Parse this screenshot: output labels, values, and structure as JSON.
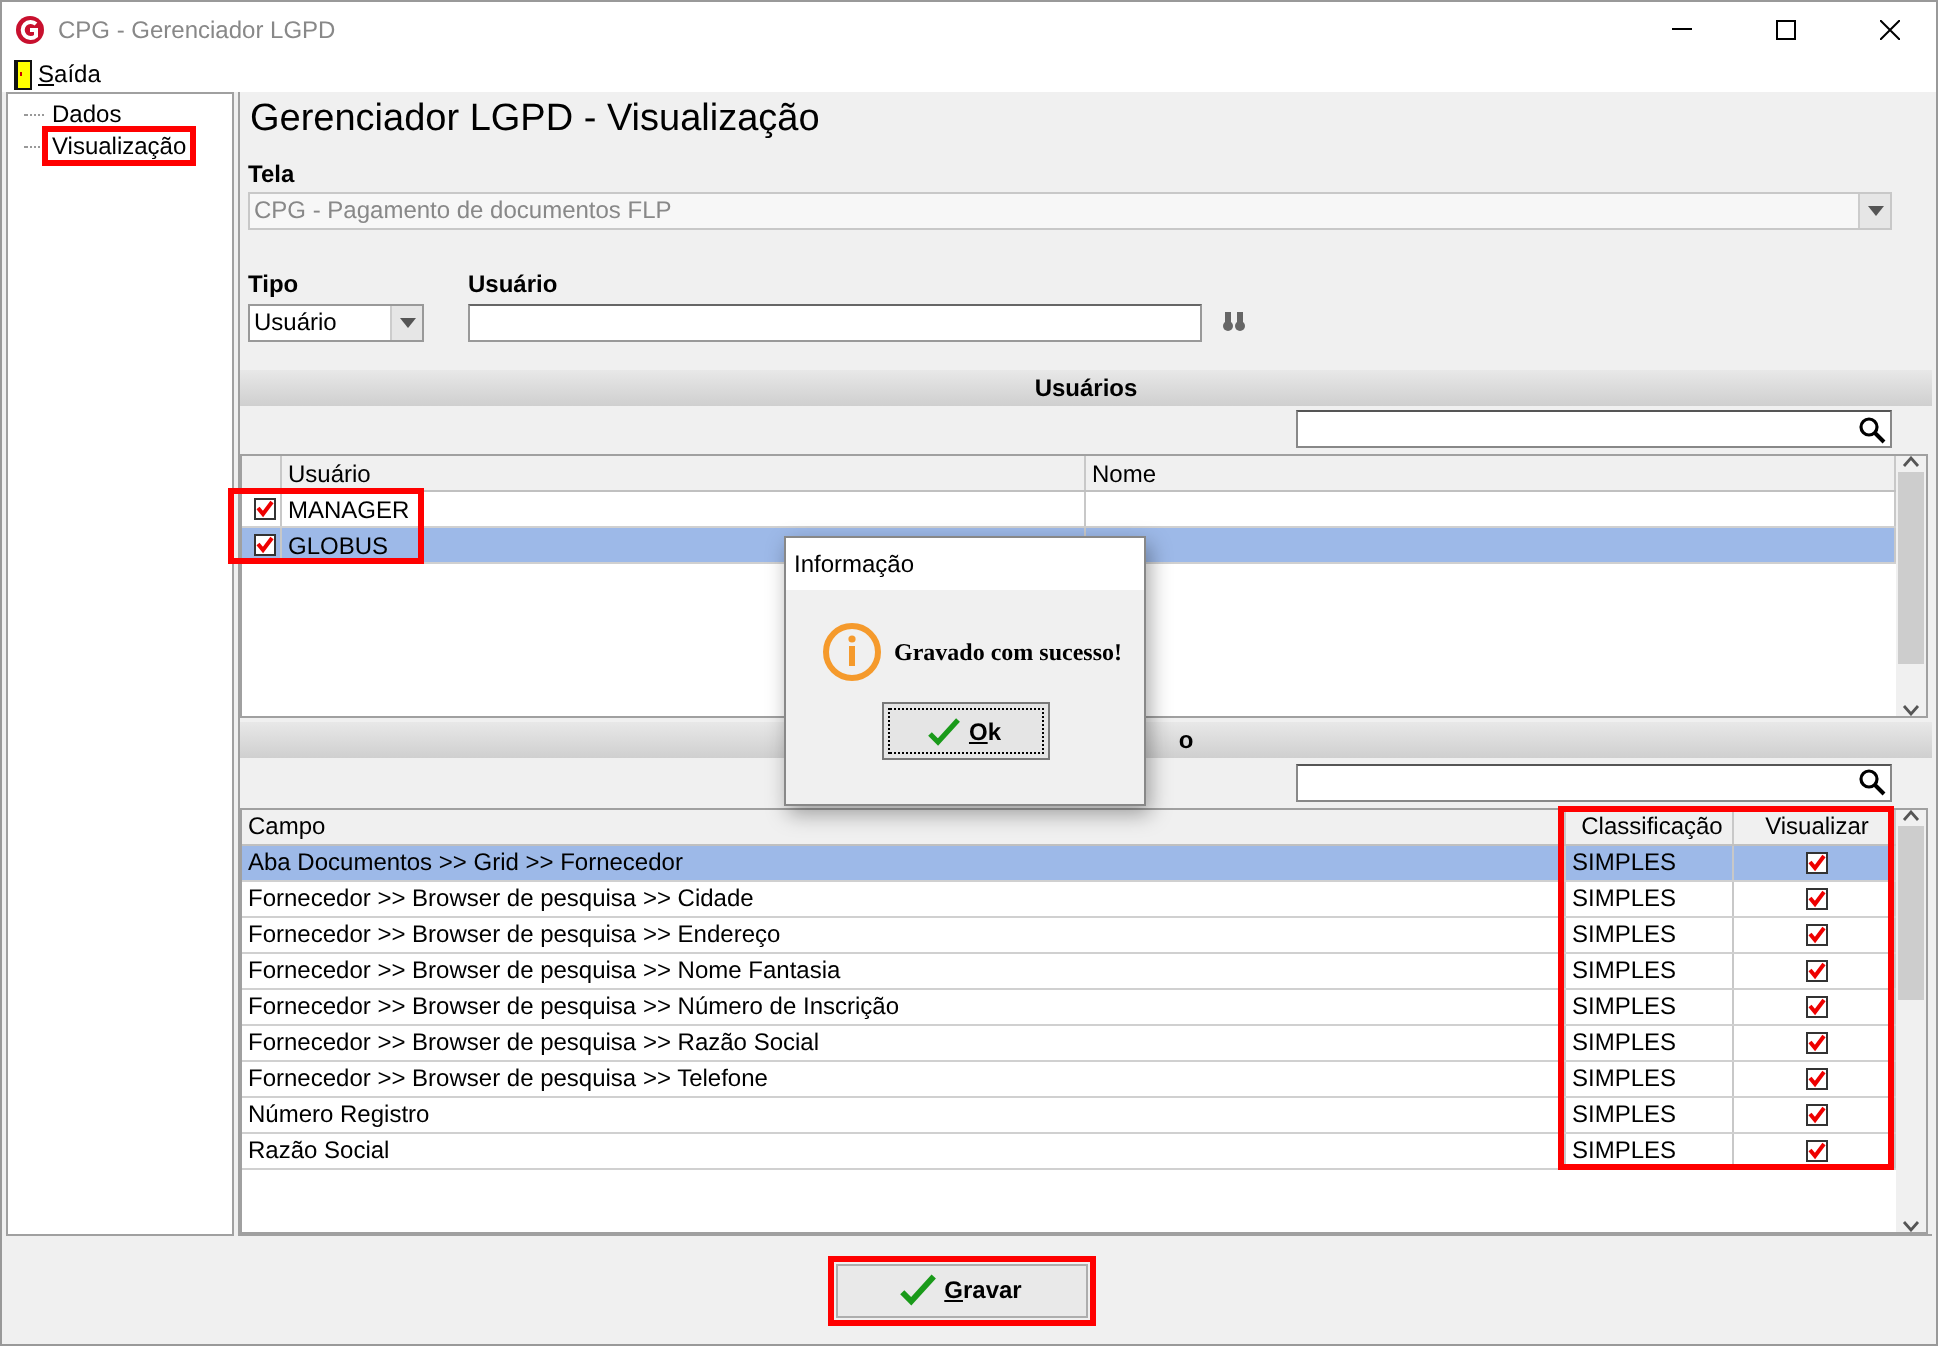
{
  "window": {
    "title": "CPG - Gerenciador LGPD"
  },
  "menu": [
    {
      "label": "Saída"
    }
  ],
  "tree": [
    {
      "label": "Dados",
      "selected": false
    },
    {
      "label": "Visualização",
      "selected": true
    }
  ],
  "page_title": "Gerenciador LGPD - Visualização",
  "tela": {
    "label": "Tela",
    "value": "CPG - Pagamento de documentos FLP",
    "disabled": true
  },
  "tipo": {
    "label": "Tipo",
    "value": "Usuário"
  },
  "usuario": {
    "label": "Usuário"
  },
  "users_section": {
    "title": "Usuários",
    "columns": [
      "Usuário",
      "Nome"
    ],
    "rows": [
      {
        "checked": true,
        "usuario": "MANAGER",
        "selected": false
      },
      {
        "checked": true,
        "usuario": "GLOBUS",
        "selected": true
      }
    ]
  },
  "fields_section": {
    "title": "o",
    "columns": [
      "Campo",
      "Classificação",
      "Visualizar"
    ],
    "rows": [
      {
        "campo": "Aba Documentos >> Grid >> Fornecedor",
        "classificacao": "SIMPLES",
        "visualizar": true,
        "selected": true
      },
      {
        "campo": "Fornecedor >> Browser de pesquisa >> Cidade",
        "classificacao": "SIMPLES",
        "visualizar": true,
        "selected": false
      },
      {
        "campo": "Fornecedor >> Browser de pesquisa >> Endereço",
        "classificacao": "SIMPLES",
        "visualizar": true,
        "selected": false
      },
      {
        "campo": "Fornecedor >> Browser de pesquisa >> Nome Fantasia",
        "classificacao": "SIMPLES",
        "visualizar": true,
        "selected": false
      },
      {
        "campo": "Fornecedor >> Browser de pesquisa >> Número de Inscrição",
        "classificacao": "SIMPLES",
        "visualizar": true,
        "selected": false
      },
      {
        "campo": "Fornecedor >> Browser de pesquisa >> Razão Social",
        "classificacao": "SIMPLES",
        "visualizar": true,
        "selected": false
      },
      {
        "campo": "Fornecedor >> Browser de pesquisa >> Telefone",
        "classificacao": "SIMPLES",
        "visualizar": true,
        "selected": false
      },
      {
        "campo": "Número Registro",
        "classificacao": "SIMPLES",
        "visualizar": true,
        "selected": false
      },
      {
        "campo": "Razão Social",
        "classificacao": "SIMPLES",
        "visualizar": true,
        "selected": false
      }
    ]
  },
  "save_button": {
    "label": "Gravar"
  },
  "dialog": {
    "title": "Informação",
    "message": "Gravado com sucesso!",
    "button": "Ok"
  }
}
